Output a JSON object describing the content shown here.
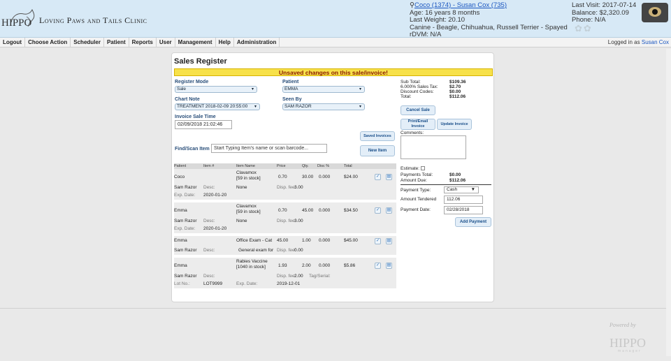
{
  "header": {
    "logo_text": "HIPPO",
    "logo_sub": "manager",
    "clinic_name": "Loving Paws and Tails Clinic",
    "patient_link": "Coco (1374) - Susan Cox (735)",
    "age": "Age: 16 years 8 months",
    "weight": "Last Weight: 20.10",
    "breed": "Canine - Beagle, Chihuahua, Russell Terrier - Spayed",
    "rdvm": "rDVM: N/A",
    "last_visit": "Last Visit: 2017-07-14",
    "balance": "Balance: $2,320.09",
    "phone": "Phone: N/A"
  },
  "nav": {
    "items": [
      "Logout",
      "Choose Action",
      "Scheduler",
      "Patient",
      "Reports",
      "User",
      "Management",
      "Help",
      "Administration"
    ],
    "logged_in_prefix": "Logged in as",
    "user": "Susan Cox"
  },
  "register": {
    "title": "Sales Register",
    "warning": "Unsaved changes on this sale/invoice!",
    "mode_label": "Register Mode",
    "mode_value": "Sale",
    "patient_label": "Patient",
    "patient_value": "EMMA",
    "chart_label": "Chart Note",
    "chart_value": "TREATMENT 2018-02-09 20:55:00",
    "seen_label": "Seen By",
    "seen_value": "SAM RAZOR",
    "time_label": "Invoice Sale Time",
    "time_value": "02/09/2018 21:02:46",
    "saved_btn": "Saved Invoices",
    "new_btn": "New Item",
    "find_label": "Find/Scan Item",
    "find_placeholder": "Start Typing Item's name or scan barcode..."
  },
  "grid": {
    "headers": [
      "Patient",
      "Item #",
      "Item Name",
      "Price",
      "Qty.",
      "Disc %",
      "Total"
    ],
    "rows": [
      {
        "patient": "Coco",
        "item_name": "Clavamox",
        "stock": "[59 in stock]",
        "price": "0.70",
        "qty": "30.00",
        "disc": "0.000",
        "total": "$24.00",
        "doctor": "Sam Razor",
        "desc_label": "Desc:",
        "desc": "None",
        "fee_label": "Disp. fee:",
        "fee": "3.00",
        "exp_label": "Exp. Date:",
        "exp": "2020-01-20"
      },
      {
        "patient": "Emma",
        "item_name": "Clavamox",
        "stock": "[59 in stock]",
        "price": "0.70",
        "qty": "45.00",
        "disc": "0.000",
        "total": "$34.50",
        "doctor": "Sam Razor",
        "desc_label": "Desc:",
        "desc": "None",
        "fee_label": "Disp. fee:",
        "fee": "3.00",
        "exp_label": "Exp. Date:",
        "exp": "2020-01-20"
      },
      {
        "patient": "Emma",
        "item_name": "Office Exam - Cat",
        "price": "45.00",
        "qty": "1.00",
        "disc": "0.000",
        "total": "$45.00",
        "doctor": "Sam Razor",
        "desc_label": "Desc:",
        "desc": "General exam for",
        "fee_label": "Disp. fee:",
        "fee": "0.00"
      },
      {
        "patient": "Emma",
        "item_name": "Rabies Vaccine",
        "stock": "[1040 in stock]",
        "price": "1.93",
        "qty": "2.00",
        "disc": "0.000",
        "total": "$5.86",
        "doctor": "Sam Razor",
        "desc_label": "Desc:",
        "fee_label": "Disp. fee:",
        "fee": "2.00",
        "tag_label": "Tag/Serial:",
        "lot_label": "Lot No.:",
        "lot": "LOT9999",
        "exp_label": "Exp. Date:",
        "exp": "2019-12-01"
      }
    ]
  },
  "summary": {
    "subtotal_label": "Sub Total:",
    "subtotal": "$109.36",
    "tax_label": "6.000% Sales Tax:",
    "tax": "$2.70",
    "discount_label": "Discount Codes:",
    "discount": "$0.00",
    "total_label": "Total:",
    "total": "$112.06",
    "cancel_btn": "Cancel Sale",
    "print_btn": "Print/Email Invoice",
    "update_btn": "Update Invoice",
    "comments_label": "Comments:",
    "estimate_label": "Estimate:",
    "payments_label": "Payments Total:",
    "payments": "$0.00",
    "due_label": "Amount Due:",
    "due": "$112.06",
    "ptype_label": "Payment Type:",
    "ptype": "Cash",
    "tendered_label": "Amount Tendered",
    "tendered": "112.06",
    "pdate_label": "Payment Date:",
    "pdate": "02/28/2018",
    "add_btn": "Add Payment"
  },
  "footer": {
    "powered": "Powered by",
    "logo": "HIPPO",
    "sub": "manager"
  }
}
